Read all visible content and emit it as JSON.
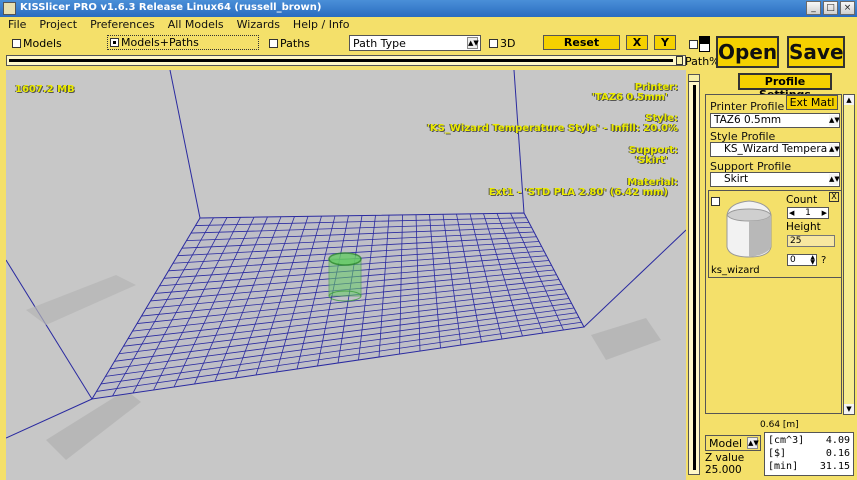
{
  "window": {
    "title": "KISSlicer PRO v1.6.3 Release Linux64 (russell_brown)",
    "controls": [
      "_",
      "□",
      "×"
    ]
  },
  "menu": [
    "File",
    "Project",
    "Preferences",
    "All Models",
    "Wizards",
    "Help / Info"
  ],
  "toolbar": {
    "models_label": "Models",
    "models_paths_label": "Models+Paths",
    "paths_label": "Paths",
    "path_type_value": "Path Type",
    "threed_label": "3D",
    "reset_label": "Reset",
    "x_label": "X",
    "y_label": "Y",
    "path_pct_label": "Path%"
  },
  "actions": {
    "open_label": "Open",
    "save_label": "Save"
  },
  "viewport": {
    "memory": "1607.2 MB",
    "printer_heading": "Printer:",
    "printer_value": "'TAZ6 0.5mm'",
    "style_heading": "Style:",
    "style_value": "'KS_Wizard Temperature Style' - Infill: 20.0%",
    "support_heading": "Support:",
    "support_value": "'Skirt'",
    "material_heading": "Material:",
    "material_value": "Ext1 - 'STD PLA 2.80' (6.42 mm)",
    "colors": {
      "background": "#c7c7c7",
      "grid": "#2a2aa0",
      "model": "#66cc66",
      "overlay_text": "#ecec00"
    }
  },
  "profile_panel": {
    "tab_label": "Profile Settings",
    "ext_matl_label": "Ext Matl",
    "printer_profile_label": "Printer Profile",
    "printer_profile_value": "TAZ6 0.5mm",
    "style_profile_label": "Style Profile",
    "style_profile_value": "KS_Wizard Tempera",
    "support_profile_label": "Support Profile",
    "support_profile_value": "Skirt",
    "model": {
      "name": "ks_wizard",
      "count_label": "Count",
      "count_value": "1",
      "height_label": "Height",
      "height_value": "25",
      "extruder_value": "0",
      "question": "?",
      "close": "X"
    },
    "size_readout": "0.64 [m]"
  },
  "footer": {
    "mode_value": "Model",
    "z_label": "Z value",
    "z_value": "25.000",
    "stats": [
      {
        "unit": "[cm^3]",
        "value": "4.09"
      },
      {
        "unit": "[$]",
        "value": "0.16"
      },
      {
        "unit": "[min]",
        "value": "31.15"
      }
    ]
  }
}
